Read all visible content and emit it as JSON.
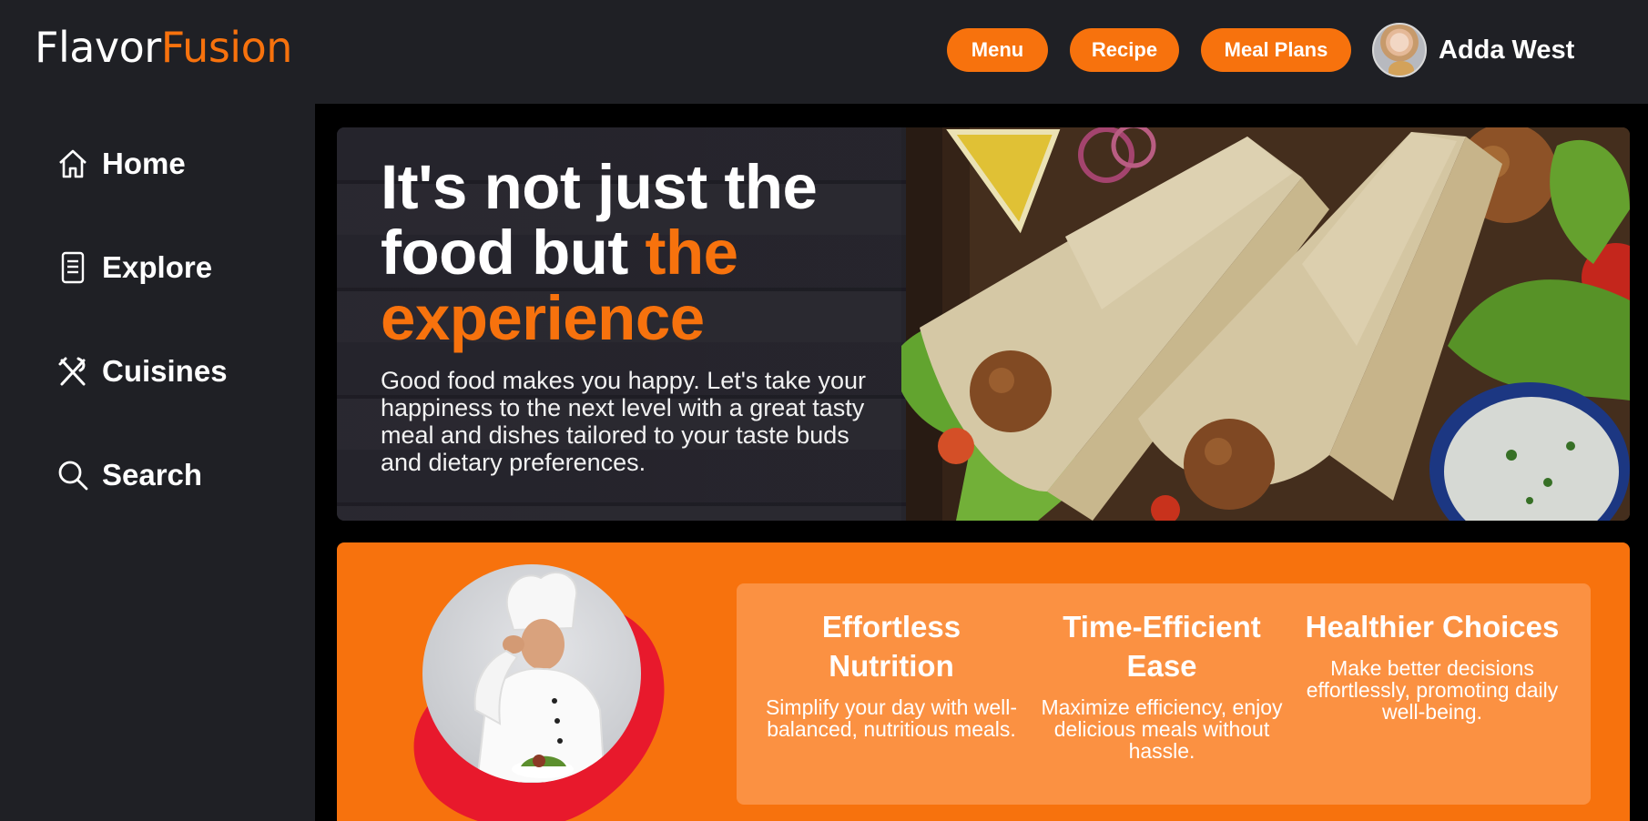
{
  "header": {
    "logo_part1": "Flavor",
    "logo_part2": "Fusion",
    "nav": {
      "menu": "Menu",
      "recipe": "Recipe",
      "meal_plans": "Meal Plans"
    },
    "user_name": "Adda West"
  },
  "sidebar": {
    "items": [
      {
        "label": "Home",
        "icon": "home-icon"
      },
      {
        "label": "Explore",
        "icon": "document-icon"
      },
      {
        "label": "Cuisines",
        "icon": "utensils-icon"
      },
      {
        "label": "Search",
        "icon": "search-icon"
      }
    ]
  },
  "hero": {
    "title_line1": "It's not just the",
    "title_line2_plain": "food but ",
    "title_line2_highlight": "the",
    "title_line3_highlight": "experience",
    "subtitle": "Good food makes you happy. Let's take your happiness to the next level with a great tasty meal and dishes tailored to your taste buds and dietary preferences."
  },
  "features": [
    {
      "title": "Effortless Nutrition",
      "text": "Simplify your day with well-balanced, nutritious meals."
    },
    {
      "title": "Time-Efficient Ease",
      "text": "Maximize efficiency, enjoy delicious meals without hassle."
    },
    {
      "title": "Healthier Choices",
      "text": "Make better decisions effortlessly, promoting daily well-being."
    }
  ],
  "colors": {
    "accent": "#f7720d",
    "panel": "#1f2025",
    "card": "#fb9142",
    "blob": "#e8192c"
  }
}
